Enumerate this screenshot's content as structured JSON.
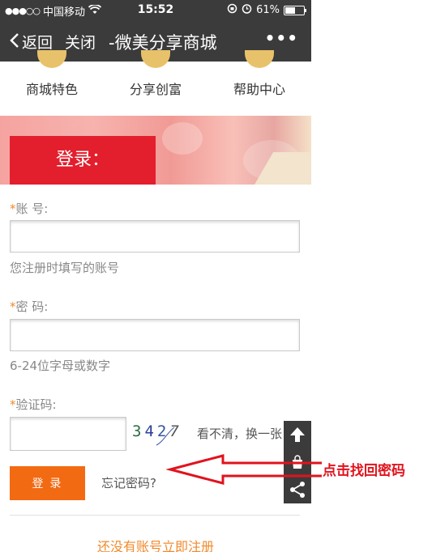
{
  "status_bar": {
    "carrier": "中国移动",
    "time": "15:52",
    "battery": "61%",
    "battery_level": 0.61
  },
  "nav": {
    "back_label": "返回",
    "close_label": "关闭",
    "title": "-微美分享商城",
    "more_label": "•••"
  },
  "menu": {
    "items": [
      {
        "label": "商城特色"
      },
      {
        "label": "分享创富"
      },
      {
        "label": "帮助中心"
      }
    ]
  },
  "login_banner": {
    "title": "登录："
  },
  "form": {
    "account": {
      "required_mark": "*",
      "label": "账 号:",
      "value": "",
      "hint": "您注册时填写的账号"
    },
    "password": {
      "required_mark": "*",
      "label": "密 码:",
      "value": "",
      "hint": "6-24位字母或数字"
    },
    "captcha": {
      "required_mark": "*",
      "label": "验证码:",
      "value": "",
      "digits": [
        "3",
        "4",
        "2",
        "7"
      ],
      "refresh_text": "看不清，换一张"
    },
    "login_button": "登 录",
    "forgot_link": "忘记密码?",
    "register_link": "还没有账号立即注册"
  },
  "float_toolbar": {
    "icons": [
      "arrow-up-icon",
      "bag-icon",
      "share-icon"
    ]
  },
  "annotation": {
    "text": "点击找回密码",
    "color": "#e1131d"
  },
  "colors": {
    "accent_orange": "#f26a12",
    "login_red": "#e31e2d",
    "nav_bg": "#3b3b3b",
    "link_orange": "#f08a2c"
  }
}
